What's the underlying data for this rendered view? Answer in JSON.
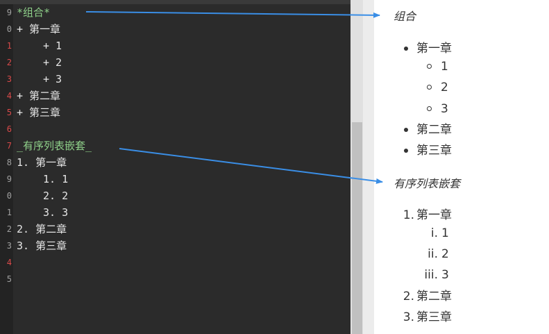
{
  "editor": {
    "line_numbers": [
      "9",
      "0",
      "1",
      "2",
      "3",
      "4",
      "5",
      "6",
      "7",
      "8",
      "9",
      "0",
      "1",
      "2",
      "3",
      "4",
      "5"
    ],
    "lines": [
      {
        "text": "*组合*",
        "green": true,
        "indent": false
      },
      {
        "text": "+ 第一章",
        "green": false,
        "indent": false
      },
      {
        "text": "+ 1",
        "green": false,
        "indent": true
      },
      {
        "text": "+ 2",
        "green": false,
        "indent": true
      },
      {
        "text": "+ 3",
        "green": false,
        "indent": true
      },
      {
        "text": "+ 第二章",
        "green": false,
        "indent": false
      },
      {
        "text": "+ 第三章",
        "green": false,
        "indent": false
      },
      {
        "text": "",
        "green": false,
        "indent": false
      },
      {
        "text": "_有序列表嵌套_",
        "green": true,
        "indent": false
      },
      {
        "text": "1. 第一章",
        "green": false,
        "indent": false
      },
      {
        "text": "1. 1",
        "green": false,
        "indent": true
      },
      {
        "text": "2. 2",
        "green": false,
        "indent": true
      },
      {
        "text": "3. 3",
        "green": false,
        "indent": true
      },
      {
        "text": "2. 第二章",
        "green": false,
        "indent": false
      },
      {
        "text": "3. 第三章",
        "green": false,
        "indent": false
      }
    ]
  },
  "preview": {
    "heading1": "组合",
    "ul": {
      "item1": "第一章",
      "sub": [
        "1",
        "2",
        "3"
      ],
      "item2": "第二章",
      "item3": "第三章"
    },
    "heading2": "有序列表嵌套",
    "ol": {
      "n1": "1.",
      "item1": "第一章",
      "sub_markers": [
        "i.",
        "ii.",
        "iii."
      ],
      "sub": [
        "1",
        "2",
        "3"
      ],
      "n2": "2.",
      "item2": "第二章",
      "n3": "3.",
      "item3": "第三章"
    }
  },
  "colors": {
    "editor_bg": "#2b2b2b",
    "green_text": "#8fd18a",
    "arrow": "#3a8ee6"
  }
}
